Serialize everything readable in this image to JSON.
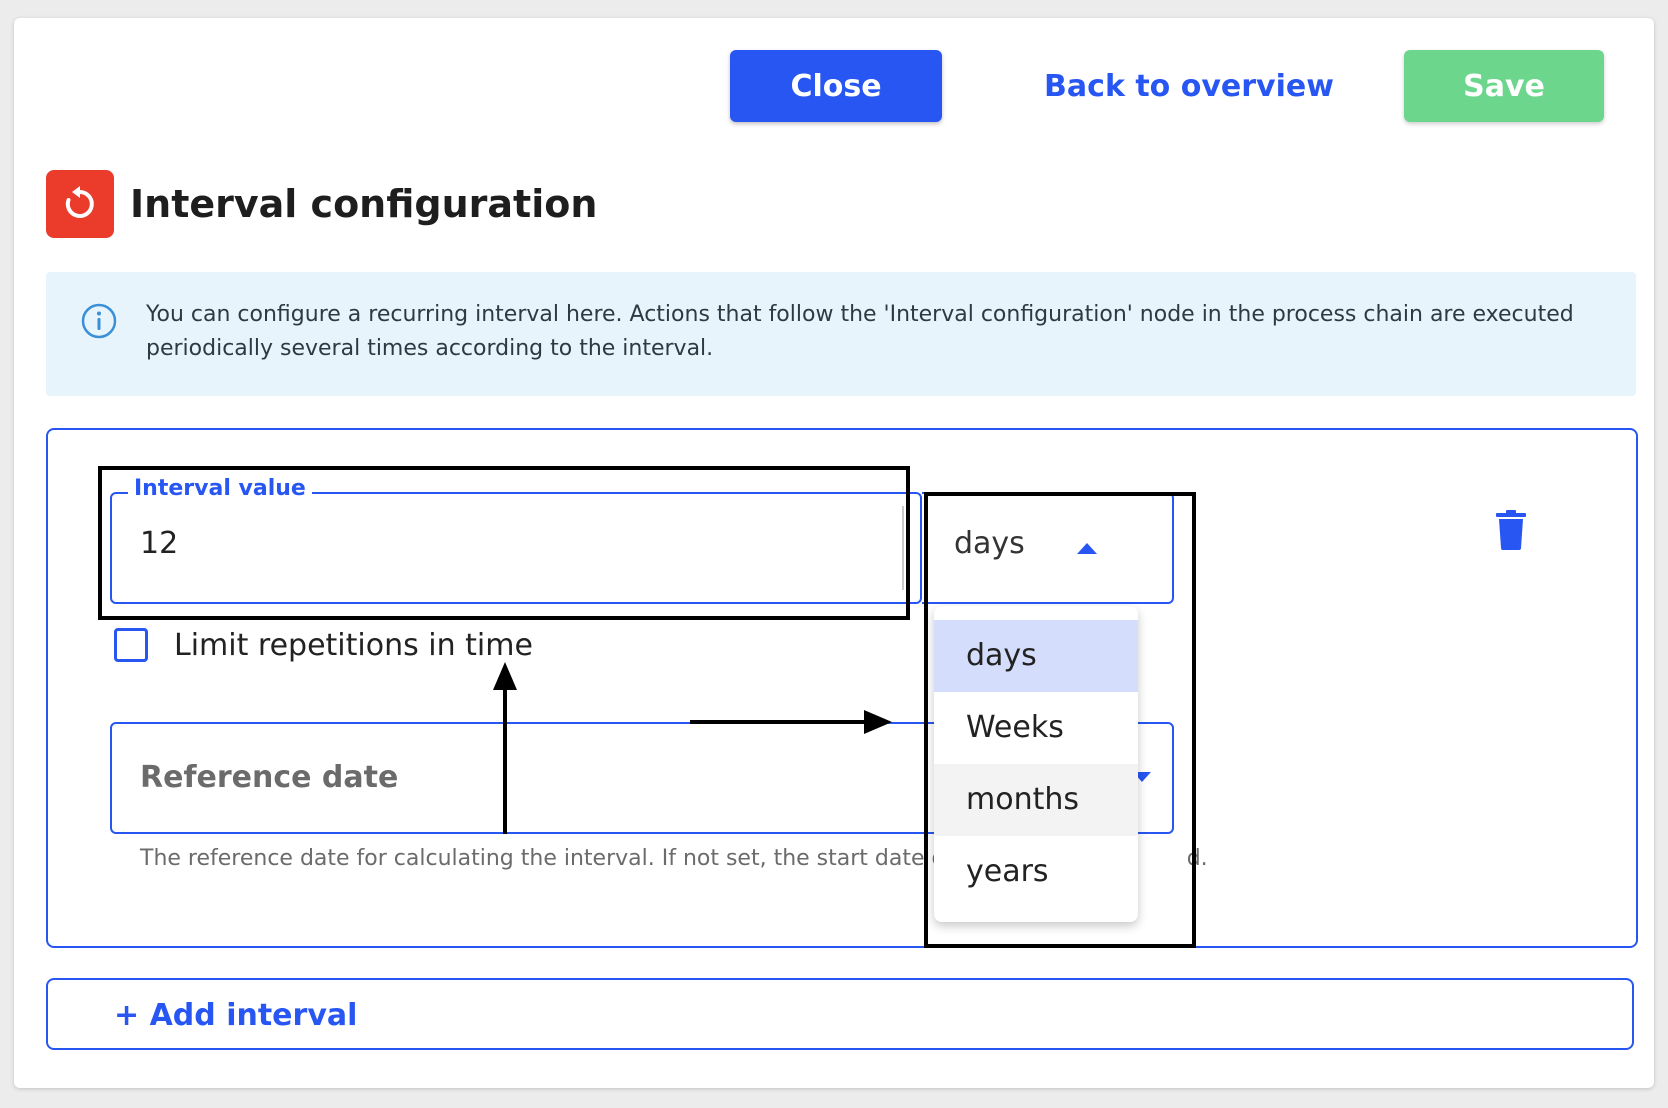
{
  "toolbar": {
    "close_label": "Close",
    "back_label": "Back to overview",
    "save_label": "Save"
  },
  "header": {
    "title": "Interval configuration",
    "icon": "restart-icon"
  },
  "info": {
    "icon": "info-icon",
    "text": "You can configure a recurring interval here. Actions that follow the 'Interval configuration' node in the process chain are executed periodically several times according to the interval."
  },
  "interval": {
    "value_label": "Interval value",
    "value": "12",
    "unit_selected": "days",
    "unit_options": [
      "days",
      "Weeks",
      "months",
      "years"
    ],
    "limit_label": "Limit repetitions in time",
    "limit_checked": false,
    "reference_placeholder": "Reference date",
    "reference_helper": "The reference date for calculating the interval. If not set, the start date of",
    "reference_helper_tail": "d."
  },
  "add_interval_label": "+ Add interval",
  "colors": {
    "primary": "#2756f2",
    "save": "#6cd68d",
    "header_icon": "#ea3b2b",
    "info_bg": "#e7f4fc",
    "selected_option": "#d4defc"
  }
}
